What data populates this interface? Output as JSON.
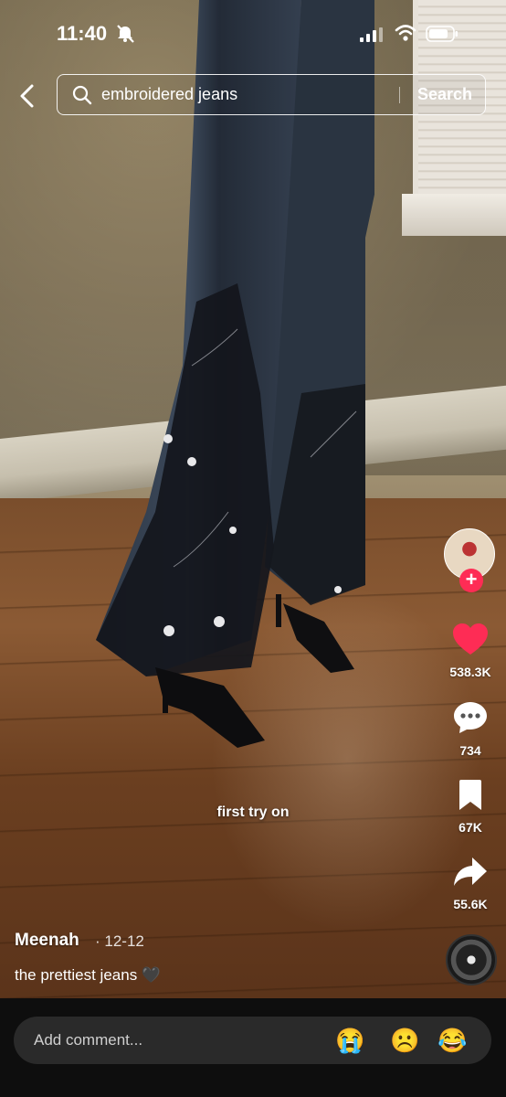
{
  "status_bar": {
    "time": "11:40"
  },
  "search": {
    "query": "embroidered jeans",
    "button_label": "Search"
  },
  "video": {
    "overlay_text": "first try on"
  },
  "actions": {
    "likes": "538.3K",
    "comments": "734",
    "saves": "67K",
    "shares": "55.6K",
    "follow_symbol": "+"
  },
  "post": {
    "author": "Meenah",
    "date": "· 12-12",
    "description": "the prettiest jeans 🖤"
  },
  "comment_bar": {
    "placeholder": "Add comment...",
    "quick_emojis": [
      "😭",
      "☹️",
      "😂"
    ]
  },
  "colors": {
    "like_red": "#fe2c55",
    "bar_bg": "#0e0e0e",
    "input_bg": "#2a2a2a"
  }
}
